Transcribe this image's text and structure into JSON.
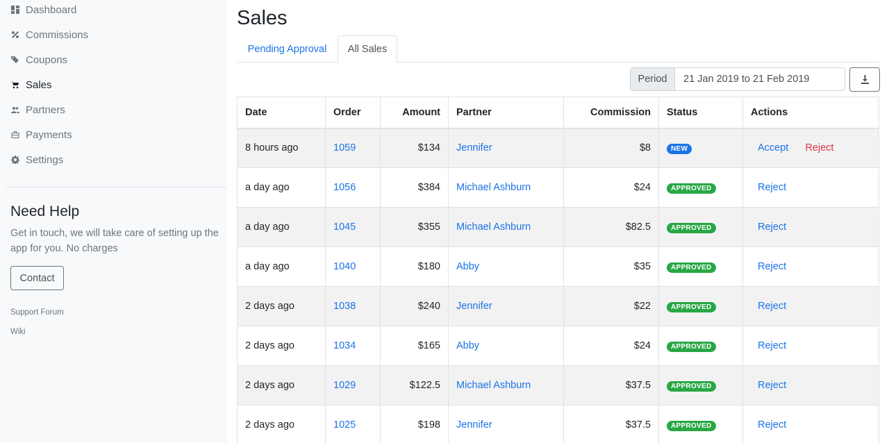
{
  "sidebar": {
    "items": [
      {
        "label": "Dashboard",
        "icon": "dashboard-icon"
      },
      {
        "label": "Commissions",
        "icon": "percent-icon"
      },
      {
        "label": "Coupons",
        "icon": "tags-icon"
      },
      {
        "label": "Sales",
        "icon": "cart-icon"
      },
      {
        "label": "Partners",
        "icon": "users-icon"
      },
      {
        "label": "Payments",
        "icon": "briefcase-icon"
      },
      {
        "label": "Settings",
        "icon": "gear-icon"
      }
    ],
    "help": {
      "title": "Need Help",
      "text": "Get in touch, we will take care of setting up the app for you. No charges",
      "contact_label": "Contact"
    },
    "links": {
      "support_forum": "Support Forum",
      "wiki": "Wiki"
    }
  },
  "page": {
    "title": "Sales"
  },
  "tabs": [
    {
      "label": "Pending Approval"
    },
    {
      "label": "All Sales"
    }
  ],
  "filter": {
    "period_label": "Period",
    "period_value": "21 Jan 2019 to 21 Feb 2019"
  },
  "table": {
    "headers": {
      "date": "Date",
      "order": "Order",
      "amount": "Amount",
      "partner": "Partner",
      "commission": "Commission",
      "status": "Status",
      "actions": "Actions"
    },
    "rows": [
      {
        "date": "8 hours ago",
        "order": "1059",
        "amount": "$134",
        "partner": "Jennifer",
        "commission": "$8",
        "status": "NEW",
        "accept": "Accept",
        "reject": "Reject"
      },
      {
        "date": "a day ago",
        "order": "1056",
        "amount": "$384",
        "partner": "Michael Ashburn",
        "commission": "$24",
        "status": "APPROVED",
        "reject": "Reject"
      },
      {
        "date": "a day ago",
        "order": "1045",
        "amount": "$355",
        "partner": "Michael Ashburn",
        "commission": "$82.5",
        "status": "APPROVED",
        "reject": "Reject"
      },
      {
        "date": "a day ago",
        "order": "1040",
        "amount": "$180",
        "partner": "Abby",
        "commission": "$35",
        "status": "APPROVED",
        "reject": "Reject"
      },
      {
        "date": "2 days ago",
        "order": "1038",
        "amount": "$240",
        "partner": "Jennifer",
        "commission": "$22",
        "status": "APPROVED",
        "reject": "Reject"
      },
      {
        "date": "2 days ago",
        "order": "1034",
        "amount": "$165",
        "partner": "Abby",
        "commission": "$24",
        "status": "APPROVED",
        "reject": "Reject"
      },
      {
        "date": "2 days ago",
        "order": "1029",
        "amount": "$122.5",
        "partner": "Michael Ashburn",
        "commission": "$37.5",
        "status": "APPROVED",
        "reject": "Reject"
      },
      {
        "date": "2 days ago",
        "order": "1025",
        "amount": "$198",
        "partner": "Jennifer",
        "commission": "$37.5",
        "status": "APPROVED",
        "reject": "Reject"
      }
    ]
  },
  "colors": {
    "link": "#1a73e8",
    "danger": "#dc3545",
    "success": "#28a745",
    "sidebar_bg": "#f8f9fa"
  }
}
